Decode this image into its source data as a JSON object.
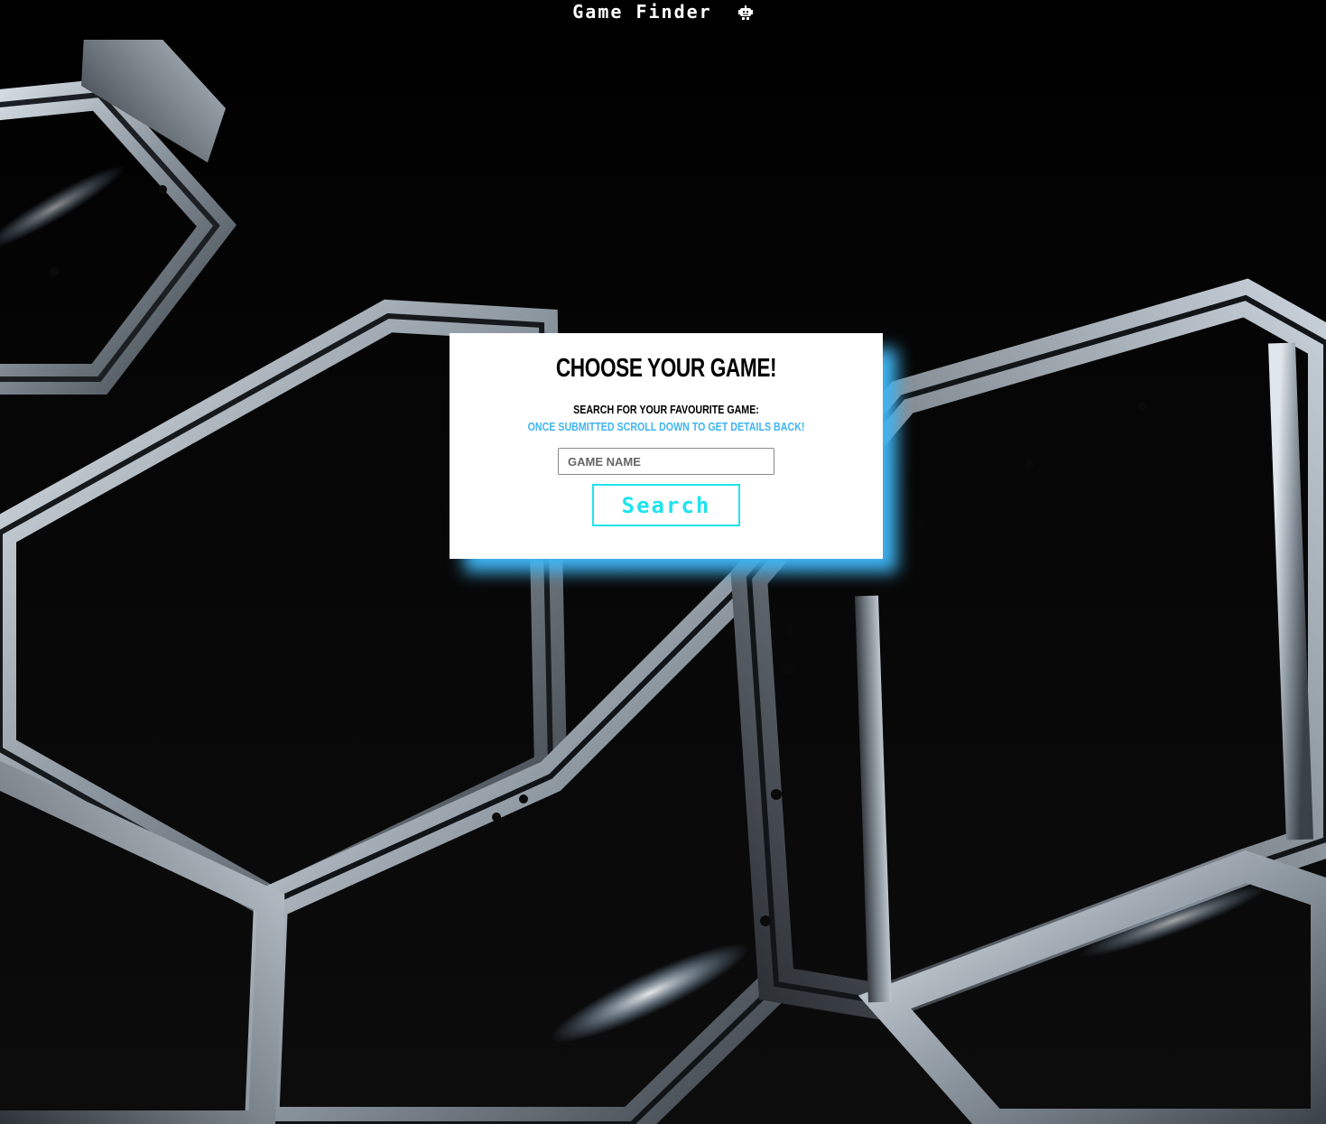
{
  "header": {
    "brand_title": "Game Finder",
    "brand_icon": "robot-icon"
  },
  "card": {
    "title": "CHOOSE YOUR GAME!",
    "subtitle": "SEARCH FOR YOUR FAVOURITE GAME:",
    "hint": "ONCE SUBMITTED SCROLL DOWN TO GET DETAILS BACK!",
    "accent_color": "#3fb4f2"
  },
  "search": {
    "placeholder": "GAME NAME",
    "value": "",
    "button_label": "Search",
    "button_color": "#1fe3ee"
  },
  "background": {
    "description_icon": "hexagon-lattice-background"
  }
}
